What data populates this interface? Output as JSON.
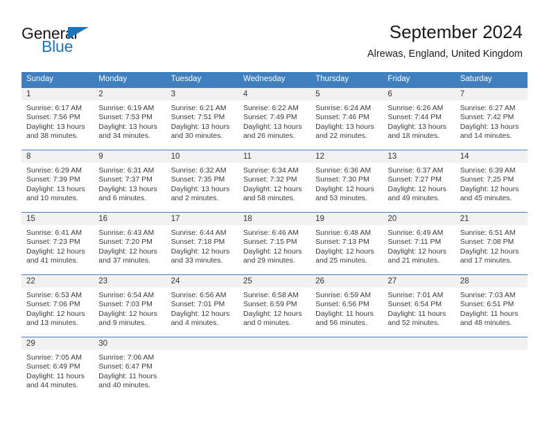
{
  "logo": {
    "word1": "General",
    "word2": "Blue",
    "accent_color": "#1b75bb",
    "triangle_icon": "triangle-icon"
  },
  "header": {
    "title": "September 2024",
    "subtitle": "Alrewas, England, United Kingdom"
  },
  "calendar": {
    "header_bg": "#3f7fbf",
    "daynum_bg": "#f1f1f1",
    "border_color": "#4a7ebb",
    "weekday_headers": [
      "Sunday",
      "Monday",
      "Tuesday",
      "Wednesday",
      "Thursday",
      "Friday",
      "Saturday"
    ],
    "weeks": [
      [
        {
          "day": "1",
          "sunrise": "Sunrise: 6:17 AM",
          "sunset": "Sunset: 7:56 PM",
          "daylight1": "Daylight: 13 hours",
          "daylight2": "and 38 minutes."
        },
        {
          "day": "2",
          "sunrise": "Sunrise: 6:19 AM",
          "sunset": "Sunset: 7:53 PM",
          "daylight1": "Daylight: 13 hours",
          "daylight2": "and 34 minutes."
        },
        {
          "day": "3",
          "sunrise": "Sunrise: 6:21 AM",
          "sunset": "Sunset: 7:51 PM",
          "daylight1": "Daylight: 13 hours",
          "daylight2": "and 30 minutes."
        },
        {
          "day": "4",
          "sunrise": "Sunrise: 6:22 AM",
          "sunset": "Sunset: 7:49 PM",
          "daylight1": "Daylight: 13 hours",
          "daylight2": "and 26 minutes."
        },
        {
          "day": "5",
          "sunrise": "Sunrise: 6:24 AM",
          "sunset": "Sunset: 7:46 PM",
          "daylight1": "Daylight: 13 hours",
          "daylight2": "and 22 minutes."
        },
        {
          "day": "6",
          "sunrise": "Sunrise: 6:26 AM",
          "sunset": "Sunset: 7:44 PM",
          "daylight1": "Daylight: 13 hours",
          "daylight2": "and 18 minutes."
        },
        {
          "day": "7",
          "sunrise": "Sunrise: 6:27 AM",
          "sunset": "Sunset: 7:42 PM",
          "daylight1": "Daylight: 13 hours",
          "daylight2": "and 14 minutes."
        }
      ],
      [
        {
          "day": "8",
          "sunrise": "Sunrise: 6:29 AM",
          "sunset": "Sunset: 7:39 PM",
          "daylight1": "Daylight: 13 hours",
          "daylight2": "and 10 minutes."
        },
        {
          "day": "9",
          "sunrise": "Sunrise: 6:31 AM",
          "sunset": "Sunset: 7:37 PM",
          "daylight1": "Daylight: 13 hours",
          "daylight2": "and 6 minutes."
        },
        {
          "day": "10",
          "sunrise": "Sunrise: 6:32 AM",
          "sunset": "Sunset: 7:35 PM",
          "daylight1": "Daylight: 13 hours",
          "daylight2": "and 2 minutes."
        },
        {
          "day": "11",
          "sunrise": "Sunrise: 6:34 AM",
          "sunset": "Sunset: 7:32 PM",
          "daylight1": "Daylight: 12 hours",
          "daylight2": "and 58 minutes."
        },
        {
          "day": "12",
          "sunrise": "Sunrise: 6:36 AM",
          "sunset": "Sunset: 7:30 PM",
          "daylight1": "Daylight: 12 hours",
          "daylight2": "and 53 minutes."
        },
        {
          "day": "13",
          "sunrise": "Sunrise: 6:37 AM",
          "sunset": "Sunset: 7:27 PM",
          "daylight1": "Daylight: 12 hours",
          "daylight2": "and 49 minutes."
        },
        {
          "day": "14",
          "sunrise": "Sunrise: 6:39 AM",
          "sunset": "Sunset: 7:25 PM",
          "daylight1": "Daylight: 12 hours",
          "daylight2": "and 45 minutes."
        }
      ],
      [
        {
          "day": "15",
          "sunrise": "Sunrise: 6:41 AM",
          "sunset": "Sunset: 7:23 PM",
          "daylight1": "Daylight: 12 hours",
          "daylight2": "and 41 minutes."
        },
        {
          "day": "16",
          "sunrise": "Sunrise: 6:43 AM",
          "sunset": "Sunset: 7:20 PM",
          "daylight1": "Daylight: 12 hours",
          "daylight2": "and 37 minutes."
        },
        {
          "day": "17",
          "sunrise": "Sunrise: 6:44 AM",
          "sunset": "Sunset: 7:18 PM",
          "daylight1": "Daylight: 12 hours",
          "daylight2": "and 33 minutes."
        },
        {
          "day": "18",
          "sunrise": "Sunrise: 6:46 AM",
          "sunset": "Sunset: 7:15 PM",
          "daylight1": "Daylight: 12 hours",
          "daylight2": "and 29 minutes."
        },
        {
          "day": "19",
          "sunrise": "Sunrise: 6:48 AM",
          "sunset": "Sunset: 7:13 PM",
          "daylight1": "Daylight: 12 hours",
          "daylight2": "and 25 minutes."
        },
        {
          "day": "20",
          "sunrise": "Sunrise: 6:49 AM",
          "sunset": "Sunset: 7:11 PM",
          "daylight1": "Daylight: 12 hours",
          "daylight2": "and 21 minutes."
        },
        {
          "day": "21",
          "sunrise": "Sunrise: 6:51 AM",
          "sunset": "Sunset: 7:08 PM",
          "daylight1": "Daylight: 12 hours",
          "daylight2": "and 17 minutes."
        }
      ],
      [
        {
          "day": "22",
          "sunrise": "Sunrise: 6:53 AM",
          "sunset": "Sunset: 7:06 PM",
          "daylight1": "Daylight: 12 hours",
          "daylight2": "and 13 minutes."
        },
        {
          "day": "23",
          "sunrise": "Sunrise: 6:54 AM",
          "sunset": "Sunset: 7:03 PM",
          "daylight1": "Daylight: 12 hours",
          "daylight2": "and 9 minutes."
        },
        {
          "day": "24",
          "sunrise": "Sunrise: 6:56 AM",
          "sunset": "Sunset: 7:01 PM",
          "daylight1": "Daylight: 12 hours",
          "daylight2": "and 4 minutes."
        },
        {
          "day": "25",
          "sunrise": "Sunrise: 6:58 AM",
          "sunset": "Sunset: 6:59 PM",
          "daylight1": "Daylight: 12 hours",
          "daylight2": "and 0 minutes."
        },
        {
          "day": "26",
          "sunrise": "Sunrise: 6:59 AM",
          "sunset": "Sunset: 6:56 PM",
          "daylight1": "Daylight: 11 hours",
          "daylight2": "and 56 minutes."
        },
        {
          "day": "27",
          "sunrise": "Sunrise: 7:01 AM",
          "sunset": "Sunset: 6:54 PM",
          "daylight1": "Daylight: 11 hours",
          "daylight2": "and 52 minutes."
        },
        {
          "day": "28",
          "sunrise": "Sunrise: 7:03 AM",
          "sunset": "Sunset: 6:51 PM",
          "daylight1": "Daylight: 11 hours",
          "daylight2": "and 48 minutes."
        }
      ],
      [
        {
          "day": "29",
          "sunrise": "Sunrise: 7:05 AM",
          "sunset": "Sunset: 6:49 PM",
          "daylight1": "Daylight: 11 hours",
          "daylight2": "and 44 minutes."
        },
        {
          "day": "30",
          "sunrise": "Sunrise: 7:06 AM",
          "sunset": "Sunset: 6:47 PM",
          "daylight1": "Daylight: 11 hours",
          "daylight2": "and 40 minutes."
        },
        {
          "day": "",
          "sunrise": "",
          "sunset": "",
          "daylight1": "",
          "daylight2": ""
        },
        {
          "day": "",
          "sunrise": "",
          "sunset": "",
          "daylight1": "",
          "daylight2": ""
        },
        {
          "day": "",
          "sunrise": "",
          "sunset": "",
          "daylight1": "",
          "daylight2": ""
        },
        {
          "day": "",
          "sunrise": "",
          "sunset": "",
          "daylight1": "",
          "daylight2": ""
        },
        {
          "day": "",
          "sunrise": "",
          "sunset": "",
          "daylight1": "",
          "daylight2": ""
        }
      ]
    ]
  }
}
